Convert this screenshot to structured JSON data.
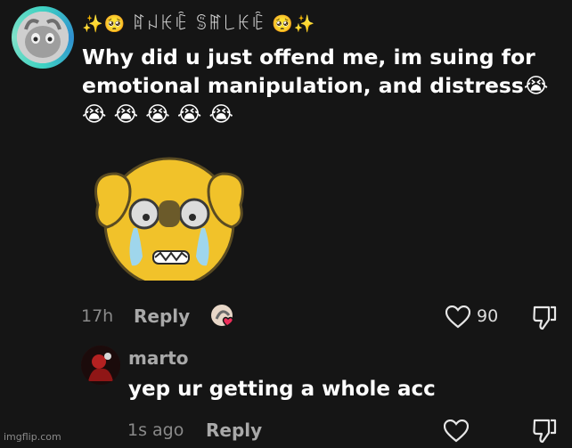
{
  "comment": {
    "username": "✨🥺 ꍏꈤꀘꍟ ꌚꂵ꒒ꀘꍟ 🥺✨",
    "text": "Why did u just offend me, im suing for emotional manipulation, and distress😭 😭 😭 😭 😭 😭",
    "time": "17h",
    "reply_label": "Reply",
    "like_count": "90"
  },
  "reply": {
    "username": "marto",
    "text": "yep ur getting a whole acc",
    "time": "1s ago",
    "reply_label": "Reply"
  },
  "watermark": "imgflip.com",
  "icons": {
    "like": "heart-outline-icon",
    "dislike": "thumbs-down-icon",
    "creator_liked": "creator-heart-avatar-icon"
  },
  "colors": {
    "background": "#151515",
    "avatar_ring": "#3fd2c2",
    "sticker_yellow": "#f1c22a"
  }
}
